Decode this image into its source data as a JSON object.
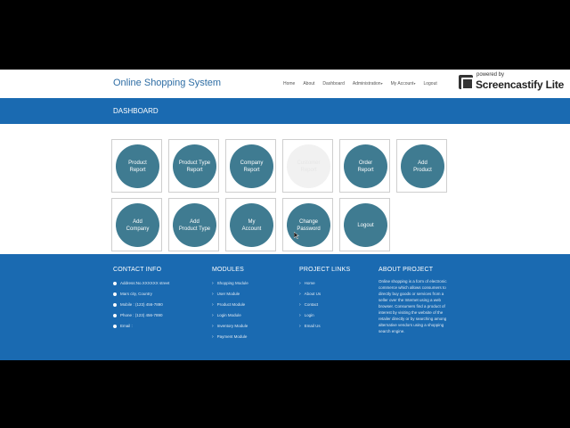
{
  "navbar": {
    "brand": "Online Shopping System",
    "items": [
      {
        "label": "Home"
      },
      {
        "label": "About"
      },
      {
        "label": "Dashboard"
      },
      {
        "label": "Administration",
        "caret": "▾"
      },
      {
        "label": "My Account",
        "caret": "▾"
      },
      {
        "label": "Logout"
      }
    ]
  },
  "watermark": {
    "small": "powered by",
    "big": "Screencastify Lite"
  },
  "dashboard": {
    "title": "DASHBOARD"
  },
  "tiles": [
    [
      "Product",
      "Report"
    ],
    [
      "Product Type",
      "Report"
    ],
    [
      "Company",
      "Report"
    ],
    [
      "Customer",
      "Report"
    ],
    [
      "Order",
      "Report"
    ],
    [
      "Add",
      "Product"
    ],
    [
      "Add",
      "Company"
    ],
    [
      "Add",
      "Product Type"
    ],
    [
      "My",
      "Account"
    ],
    [
      "Change",
      "Password"
    ],
    [
      "Logout",
      ""
    ]
  ],
  "footer": {
    "contact": {
      "title": "CONTACT INFO",
      "lines": [
        "Address:No.XXXXXX street",
        "Mars city, Country",
        "Mobile : (123) 456-7890",
        "Phone : (123) 456-7890",
        "Email :"
      ]
    },
    "modules": {
      "title": "MODULES",
      "items": [
        "Shopping Module",
        "User Module",
        "Product Module",
        "Login Module",
        "Inventory Module",
        "Payment Module"
      ]
    },
    "links": {
      "title": "PROJECT LINKS",
      "items": [
        "Home",
        "About Us",
        "Contact",
        "Login",
        "Email Us"
      ]
    },
    "about": {
      "title": "ABOUT PROJECT",
      "text": "Online shopping is a form of electronic commerce which allows consumers to directly buy goods or services from a seller over the Internet using a web browser. Consumers find a product of interest by visiting the website of the retailer directly or by searching among alternative vendors using a shopping search engine."
    }
  },
  "colors": {
    "accent": "#1a6ab1",
    "tile_circle": "#3f7b91",
    "brand": "#2e6da4"
  }
}
